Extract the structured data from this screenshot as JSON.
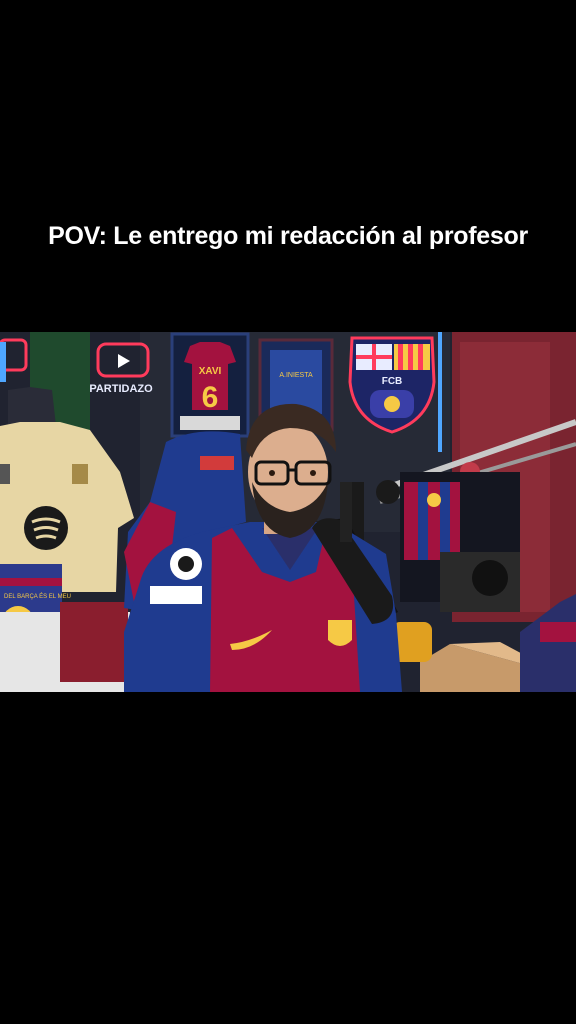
{
  "caption": "POV: Le entrego mi redacción al profesor",
  "frame_texts": {
    "jersey_name": "XAVI",
    "jersey_number": "6",
    "frame2_name": "A.INIESTA",
    "crest_text": "FCB",
    "neon_sign": "PARTIDAZO",
    "box_text": "DEL BARÇA ÉS EL MEU"
  },
  "colors": {
    "background": "#000000",
    "caption": "#ffffff",
    "blaugrana_blue": "#1f3b8f",
    "blaugrana_red": "#a3123f",
    "neon_red": "#ff3b5c",
    "neon_blue": "#4fa7ff"
  }
}
